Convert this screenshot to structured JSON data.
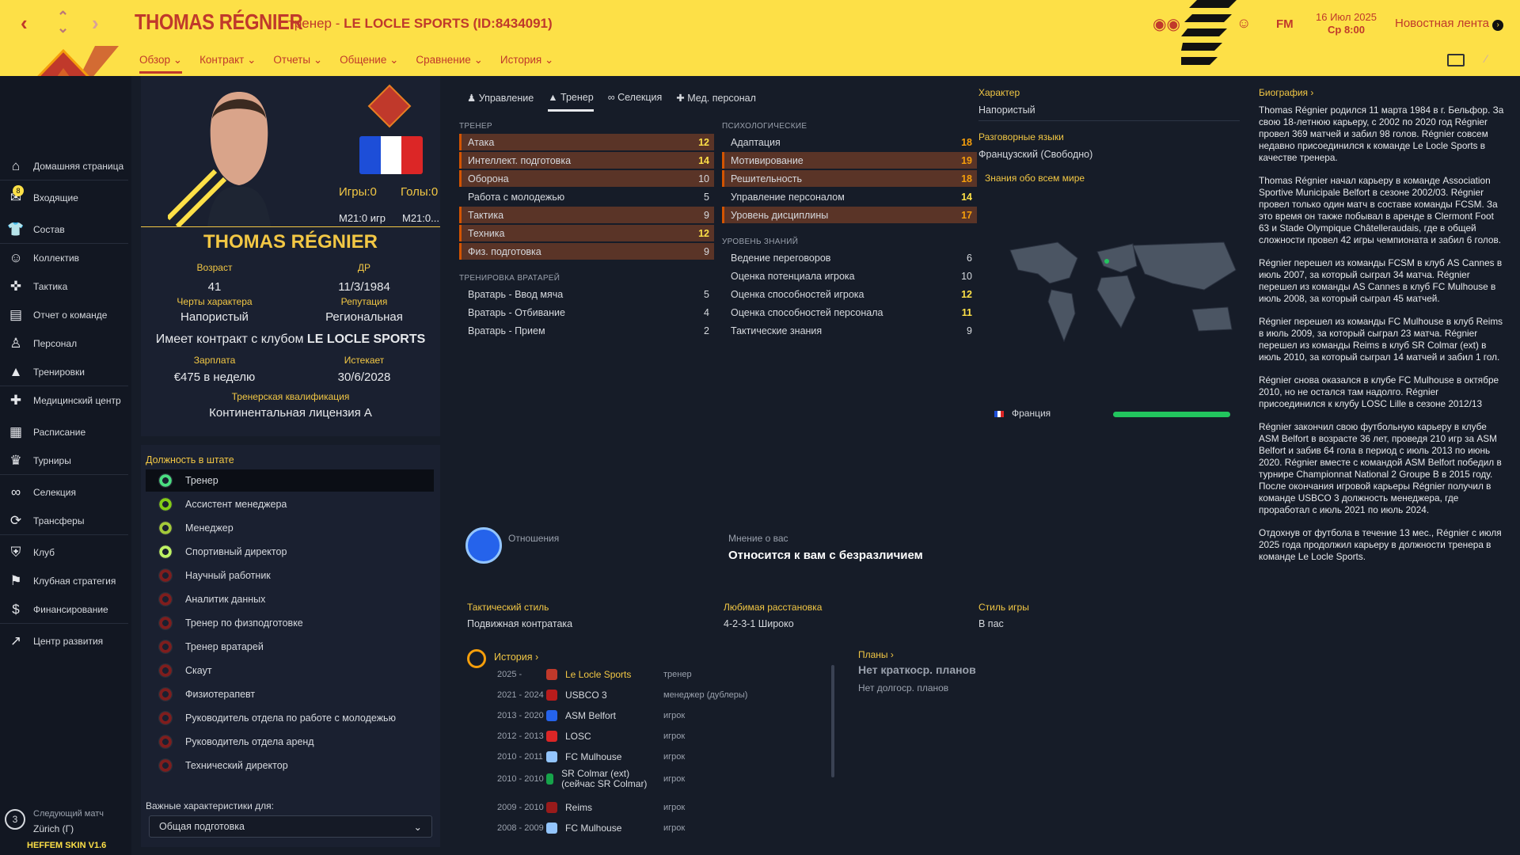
{
  "header": {
    "title": "THOMAS RÉGNIER",
    "subtitle_prefix": "тренер - ",
    "subtitle_club": "LE LOCLE SPORTS (ID:8434091)",
    "tabs": [
      "Обзор",
      "Контракт",
      "Отчеты",
      "Общение",
      "Сравнение",
      "История"
    ],
    "fm_label": "FM",
    "date_line1": "16 Июл 2025",
    "date_line2": "Ср 8:00",
    "news_label": "Новостная лента"
  },
  "sidebar": {
    "items": [
      {
        "label": "Домашняя страница",
        "icon": "home-icon"
      },
      {
        "label": "Входящие",
        "icon": "inbox-icon",
        "badge": "8"
      },
      {
        "label": "Состав",
        "icon": "shirt-icon"
      },
      {
        "label": "Коллектив",
        "icon": "people-icon"
      },
      {
        "label": "Тактика",
        "icon": "tactics-icon"
      },
      {
        "label": "Отчет о команде",
        "icon": "report-icon"
      },
      {
        "label": "Персонал",
        "icon": "staff-icon"
      },
      {
        "label": "Тренировки",
        "icon": "training-icon"
      },
      {
        "label": "Медицинский центр",
        "icon": "medical-icon"
      },
      {
        "label": "Расписание",
        "icon": "calendar-icon"
      },
      {
        "label": "Турниры",
        "icon": "trophy-icon"
      },
      {
        "label": "Селекция",
        "icon": "binoculars-icon"
      },
      {
        "label": "Трансферы",
        "icon": "transfer-icon"
      },
      {
        "label": "Клуб",
        "icon": "shield-icon"
      },
      {
        "label": "Клубная стратегия",
        "icon": "strategy-icon"
      },
      {
        "label": "Финансирование",
        "icon": "money-icon"
      },
      {
        "label": "Центр развития",
        "icon": "development-icon"
      }
    ],
    "next_match_label": "Следующий матч",
    "next_match_value": "Zürich (Г)",
    "next_match_num": "3",
    "skin": "HEFFEM SKIN V1.6"
  },
  "profile": {
    "games_label": "Игры:",
    "games_value": "0",
    "goals_label": "Голы:",
    "goals_value": "0",
    "m1": "М21:0 игр",
    "m2": "М21:0...",
    "name": "THOMAS RÉGNIER",
    "age_label": "Возраст",
    "age": "41",
    "dob_label": "ДР",
    "dob": "11/3/1984",
    "traits_label": "Черты характера",
    "traits": "Напористый",
    "rep_label": "Репутация",
    "rep": "Региональная",
    "contract_prefix": "Имеет контракт с клубом",
    "contract_club": "LE LOCLE SPORTS",
    "wage_label": "Зарплата",
    "wage": "€475 в неделю",
    "expires_label": "Истекает",
    "expires": "30/6/2028",
    "qual_label": "Тренерская квалификация",
    "qual": "Континентальная лицензия А"
  },
  "roles": {
    "title": "Должность в штате",
    "items": [
      {
        "label": "Тренер",
        "color": "#4ade80"
      },
      {
        "label": "Ассистент менеджера",
        "color": "#84cc16"
      },
      {
        "label": "Менеджер",
        "color": "#a3c93a"
      },
      {
        "label": "Спортивный директор",
        "color": "#bef264"
      },
      {
        "label": "Научный работник",
        "color": "#7f1d1d"
      },
      {
        "label": "Аналитик данных",
        "color": "#7f1d1d"
      },
      {
        "label": "Тренер по физподготовке",
        "color": "#7f1d1d"
      },
      {
        "label": "Тренер вратарей",
        "color": "#7f1d1d"
      },
      {
        "label": "Скаут",
        "color": "#7f1d1d"
      },
      {
        "label": "Физиотерапевт",
        "color": "#7f1d1d"
      },
      {
        "label": "Руководитель отдела по работе с молодежью",
        "color": "#7f1d1d"
      },
      {
        "label": "Руководитель отдела аренд",
        "color": "#7f1d1d"
      },
      {
        "label": "Технический директор",
        "color": "#7f1d1d"
      }
    ],
    "key_label": "Важные характеристики для:",
    "key_value": "Общая подготовка"
  },
  "attr_tabs": [
    "Управление",
    "Тренер",
    "Селекция",
    "Мед. персонал"
  ],
  "coach": {
    "title": "ТРЕНЕР",
    "rows": [
      {
        "label": "Атака",
        "value": "12",
        "hi": true
      },
      {
        "label": "Интеллект. подготовка",
        "value": "14",
        "hi": true
      },
      {
        "label": "Оборона",
        "value": "10",
        "hi": true
      },
      {
        "label": "Работа с молодежью",
        "value": "5",
        "hi": false
      },
      {
        "label": "Тактика",
        "value": "9",
        "hi": true
      },
      {
        "label": "Техника",
        "value": "12",
        "hi": true
      },
      {
        "label": "Физ. подготовка",
        "value": "9",
        "hi": true
      }
    ]
  },
  "gk": {
    "title": "ТРЕНИРОВКА ВРАТАРЕЙ",
    "rows": [
      {
        "label": "Вратарь - Ввод мяча",
        "value": "5"
      },
      {
        "label": "Вратарь - Отбивание",
        "value": "4"
      },
      {
        "label": "Вратарь - Прием",
        "value": "2"
      }
    ]
  },
  "psych": {
    "title": "ПСИХОЛОГИЧЕСКИЕ",
    "rows": [
      {
        "label": "Адаптация",
        "value": "18",
        "hi": false
      },
      {
        "label": "Мотивирование",
        "value": "19",
        "hi": true
      },
      {
        "label": "Решительность",
        "value": "18",
        "hi": true
      },
      {
        "label": "Управление персоналом",
        "value": "14",
        "hi": false
      },
      {
        "label": "Уровень дисциплины",
        "value": "17",
        "hi": true
      }
    ]
  },
  "knowledge": {
    "title": "УРОВЕНЬ ЗНАНИЙ",
    "rows": [
      {
        "label": "Ведение переговоров",
        "value": "6"
      },
      {
        "label": "Оценка потенциала игрока",
        "value": "10"
      },
      {
        "label": "Оценка способностей игрока",
        "value": "12"
      },
      {
        "label": "Оценка способностей персонала",
        "value": "11"
      },
      {
        "label": "Тактические знания",
        "value": "9"
      }
    ]
  },
  "character": {
    "label": "Характер",
    "value": "Напористый",
    "lang_label": "Разговорные языки",
    "lang_value": "Французский (Свободно)",
    "world_label": "Знания обо всем мире",
    "country": "Франция",
    "country_level": 1.0
  },
  "relations": {
    "label": "Отношения",
    "opinion_label": "Мнение о вас",
    "opinion_value": "Относится к вам с безразличием"
  },
  "style": {
    "tac_label": "Тактический стиль",
    "tac_value": "Подвижная контратака",
    "form_label": "Любимая расстановка",
    "form_value": "4-2-3-1 Широко",
    "play_label": "Стиль игры",
    "play_value": "В пас"
  },
  "history": {
    "title": "История",
    "rows": [
      {
        "years": "2025 -",
        "club": "Le Locle Sports",
        "role": "тренер",
        "color": "#c0392b",
        "highlight": true
      },
      {
        "years": "2021 - 2024",
        "club": "USBCO 3",
        "role": "менеджер (дублеры)",
        "color": "#b91c1c",
        "highlight": false
      },
      {
        "years": "2013 - 2020",
        "club": "ASM Belfort",
        "role": "игрок",
        "color": "#2563eb",
        "highlight": false
      },
      {
        "years": "2012 - 2013",
        "club": "LOSC",
        "role": "игрок",
        "color": "#dc2626",
        "highlight": false
      },
      {
        "years": "2010 - 2011",
        "club": "FC Mulhouse",
        "role": "игрок",
        "color": "#93c5fd",
        "highlight": false
      },
      {
        "years": "2010 - 2010",
        "club": "SR Colmar (ext) (сейчас SR Colmar)",
        "role": "игрок",
        "color": "#16a34a",
        "highlight": false
      },
      {
        "years": "2009 - 2010",
        "club": "Reims",
        "role": "игрок",
        "color": "#991b1b",
        "highlight": false
      },
      {
        "years": "2008 - 2009",
        "club": "FC Mulhouse",
        "role": "игрок",
        "color": "#93c5fd",
        "highlight": false
      }
    ]
  },
  "plans": {
    "title": "Планы",
    "short": "Нет краткоср. планов",
    "long": "Нет долгоср. планов"
  },
  "bio": {
    "title": "Биография",
    "paragraphs": [
      "Thomas Régnier родился 11 марта 1984 в г. Бельфор. За свою 18-летнюю карьеру, с 2002 по 2020 год Régnier провел 369 матчей и забил 98 голов. Régnier совсем недавно присоединился к команде Le Locle Sports в качестве тренера.",
      "Thomas Régnier начал карьеру в команде Association Sportive Municipale Belfort в сезоне 2002/03. Régnier провел только один матч в составе команды FCSM. За это время он также побывал в аренде в Clermont Foot 63 и Stade Olympique Châtelleraudais, где в общей сложности провел 42 игры чемпионата и забил 6 голов.",
      "Régnier перешел из команды FCSM в клуб AS Cannes в июль 2007, за который сыграл 34 матча. Régnier перешел из команды AS Cannes в клуб FC Mulhouse в июль 2008, за который сыграл 45 матчей.",
      "Régnier перешел из команды FC Mulhouse в клуб Reims в июль 2009, за который сыграл 23 матча. Régnier перешел из команды Reims в клуб SR Colmar (ext) в июль 2010, за который сыграл 14 матчей и забил 1 гол.",
      "Régnier снова оказался в клубе FC Mulhouse в октябре 2010, но не остался там надолго. Régnier присоединился к клубу LOSC Lille в сезоне 2012/13",
      "Régnier закончил свою футбольную карьеру в клубе ASM Belfort в возрасте 36 лет, проведя 210 игр за ASM Belfort и забив 64 гола в период с июль 2013 по июнь 2020. Régnier вместе с командой ASM Belfort победил в турнире Championnat National 2 Groupe B в 2015 году. После окончания игровой карьеры Régnier получил в команде USBCO 3 должность менеджера, где проработал с июль 2021 по июль 2024.",
      "Отдохнув от футбола в течение 13 мес., Régnier с июля 2025 года продолжил карьеру в должности тренера в команде Le Locle Sports."
    ]
  }
}
